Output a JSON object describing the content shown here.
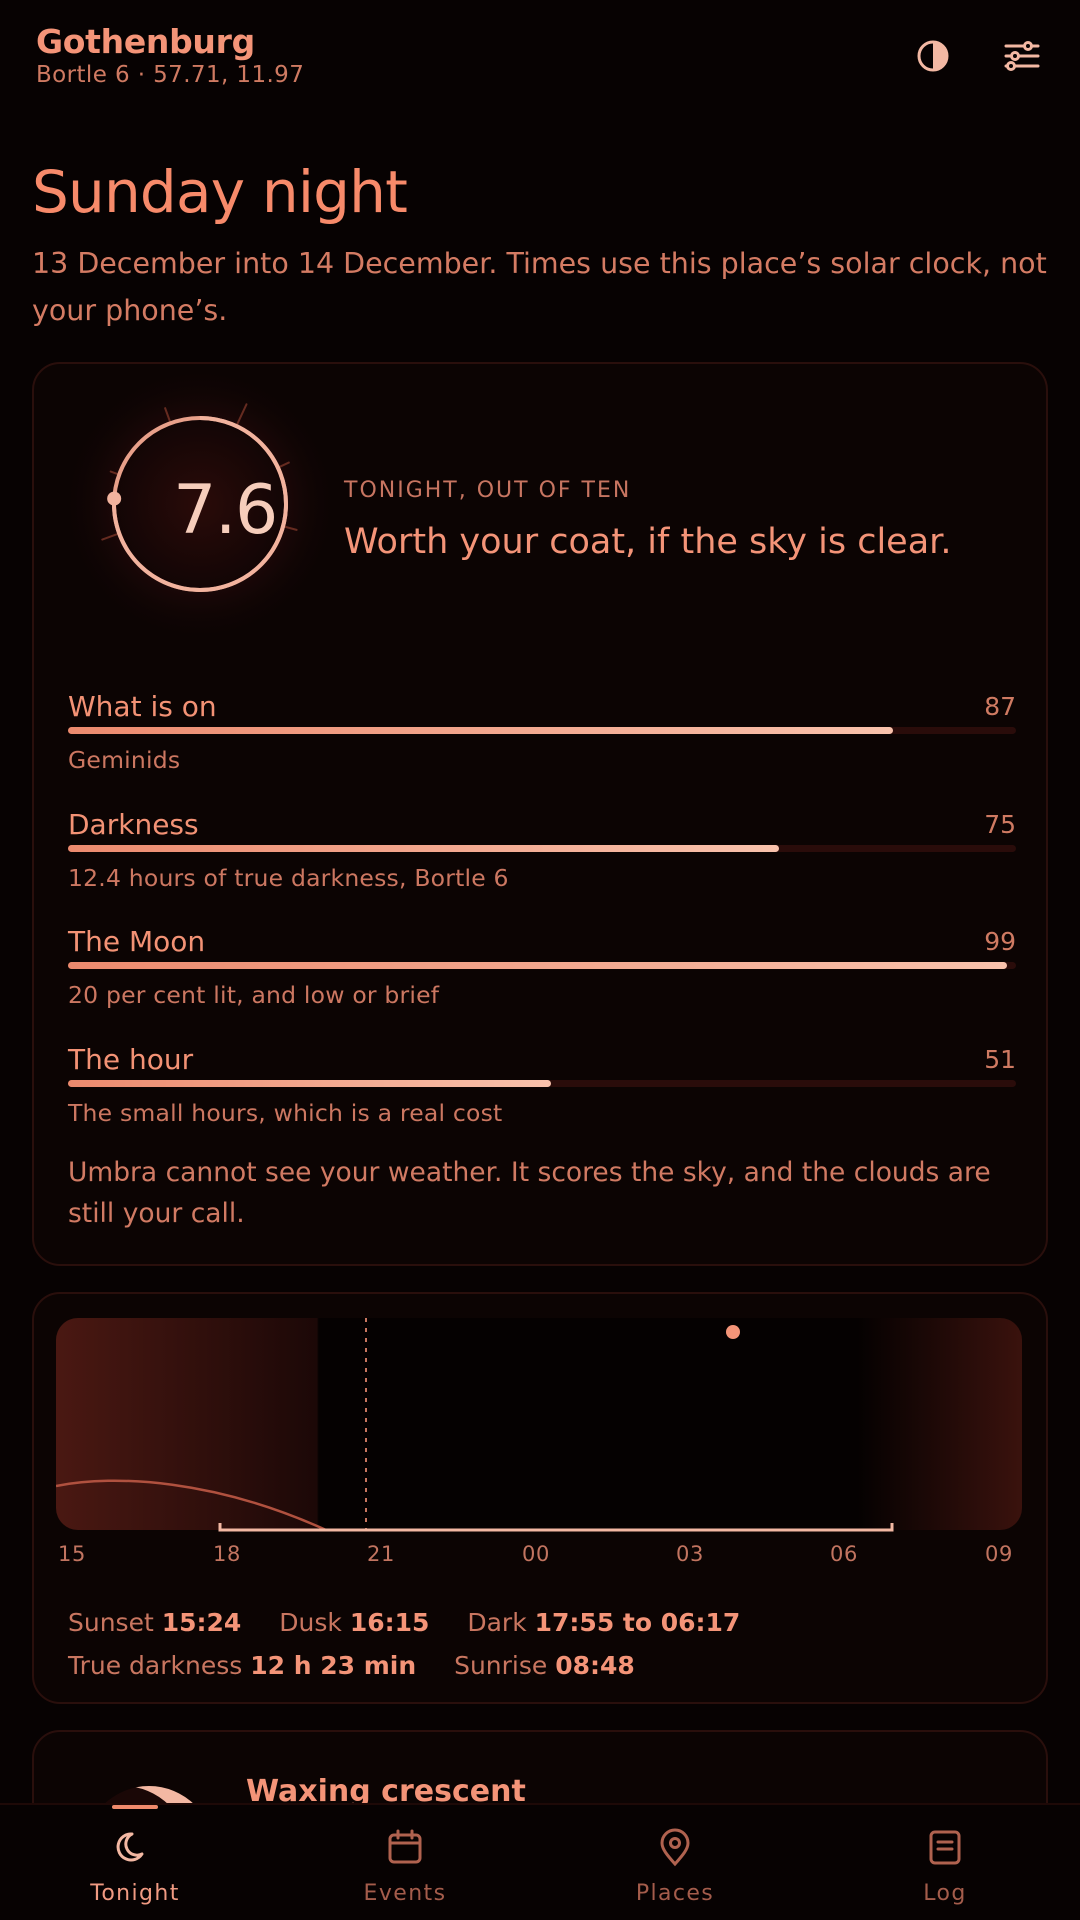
{
  "header": {
    "place": "Gothenburg",
    "subtitle": "Bortle 6 · 57.71, 11.97",
    "icons": [
      "contrast-icon",
      "sliders-icon"
    ]
  },
  "title": "Sunday night",
  "lede": "13 December into 14 December. Times use this place’s solar clock, not your phone’s.",
  "score": {
    "value": "7.6",
    "fraction": 0.76,
    "kicker": "TONIGHT, OUT OF TEN",
    "verdict": "Worth your coat, if the sky is clear.",
    "factors": [
      {
        "label": "What is on",
        "score": 87,
        "note": "Geminids"
      },
      {
        "label": "Darkness",
        "score": 75,
        "note": "12.4 hours of true darkness, Bortle 6"
      },
      {
        "label": "The Moon",
        "score": 99,
        "note": "20 per cent lit, and low or brief"
      },
      {
        "label": "The hour",
        "score": 51,
        "note": "The small hours, which is a real cost"
      }
    ],
    "weather_note": "Umbra cannot see your weather. It scores the sky, and the clouds are still your call."
  },
  "timeline": {
    "ticks": [
      "15",
      "18",
      "21",
      "00",
      "03",
      "06",
      "09"
    ],
    "facts": [
      {
        "label": "Sunset",
        "value": "15:24"
      },
      {
        "label": "Dusk",
        "value": "16:15"
      },
      {
        "label": "Dark",
        "value": "17:55 to 06:17"
      },
      {
        "label": "True darkness",
        "value": "12 h 23 min"
      },
      {
        "label": "Sunrise",
        "value": "08:48"
      }
    ]
  },
  "moon": {
    "phase": "Waxing crescent"
  },
  "nav": {
    "items": [
      {
        "label": "Tonight",
        "icon": "moon-icon",
        "active": true
      },
      {
        "label": "Events",
        "icon": "calendar-icon",
        "active": false
      },
      {
        "label": "Places",
        "icon": "location-pin-icon",
        "active": false
      },
      {
        "label": "Log",
        "icon": "notebook-icon",
        "active": false
      }
    ]
  },
  "colors": {
    "background": "#070202",
    "accent": "#f08a6c",
    "accent_light": "#f9c2ac",
    "card_border": "#2a0f0c"
  }
}
